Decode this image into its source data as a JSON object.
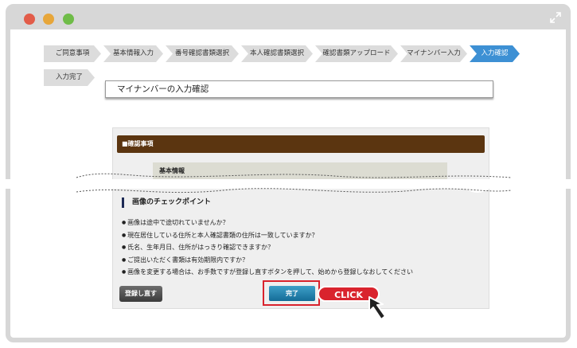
{
  "steps": [
    "ご同意事項",
    "基本情報入力",
    "番号確認書類選択",
    "本人確認書類選択",
    "確認書類アップロード",
    "マイナンバー入力",
    "入力確認",
    "入力完了"
  ],
  "active_step": "入力確認",
  "page_title": "マイナンバーの入力確認",
  "panel": {
    "header": "■確認事項",
    "basic_info": "基本情報"
  },
  "check": {
    "title": "画像のチェックポイント",
    "items": [
      "画像は途中で途切れていませんか？",
      "現在居住している住所と本人確認書類の住所は一致していますか？",
      "氏名、生年月日、住所がはっきり確認できますか？",
      "ご提出いただく書類は有効期限内ですか？",
      "画像を変更する場合は、お手数ですが登録し直すボタンを押して、始めから登録しなおしてください"
    ]
  },
  "buttons": {
    "retry": "登録し直す",
    "done": "完了"
  },
  "callout": "CLICK",
  "colors": {
    "active_step": "#3d90d4",
    "panel_header": "#5b3510",
    "highlight": "#d9232d",
    "done_button": "#1e7fae"
  }
}
